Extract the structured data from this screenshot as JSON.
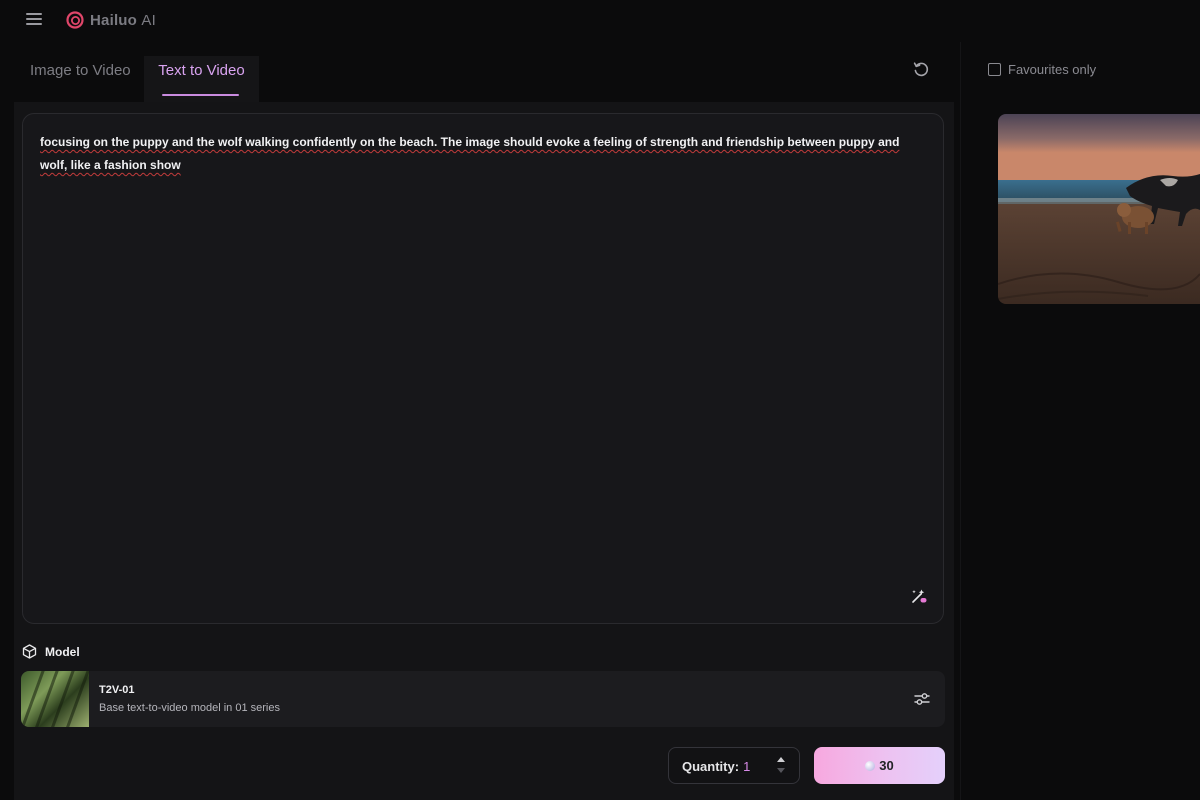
{
  "app": {
    "name": "Hailuo",
    "name_suffix": "AI"
  },
  "tabs": [
    {
      "label": "Image to Video",
      "active": false
    },
    {
      "label": "Text to Video",
      "active": true
    }
  ],
  "prompt": {
    "text": "focusing on the puppy and the wolf walking confidently on the beach. The image should evoke a feeling of strength and friendship between puppy and wolf, like a fashion show"
  },
  "model": {
    "section_label": "Model",
    "name": "T2V-01",
    "description": "Base text-to-video model in 01 series"
  },
  "quantity": {
    "label": "Quantity:",
    "value": "1"
  },
  "generate": {
    "credits": "30"
  },
  "sidebar": {
    "favourites_label": "Favourites only",
    "favourites_checked": false
  },
  "colors": {
    "accent": "#d98be9",
    "tab_active": "#d9a3f0",
    "button_gradient_start": "#f7a8df",
    "button_gradient_end": "#e4d0fb"
  },
  "icons": [
    "menu-icon",
    "hailuo-logo-icon",
    "reset-icon",
    "magic-enhance-icon",
    "cube-icon",
    "sliders-icon",
    "gem-icon",
    "checkbox-icon"
  ]
}
